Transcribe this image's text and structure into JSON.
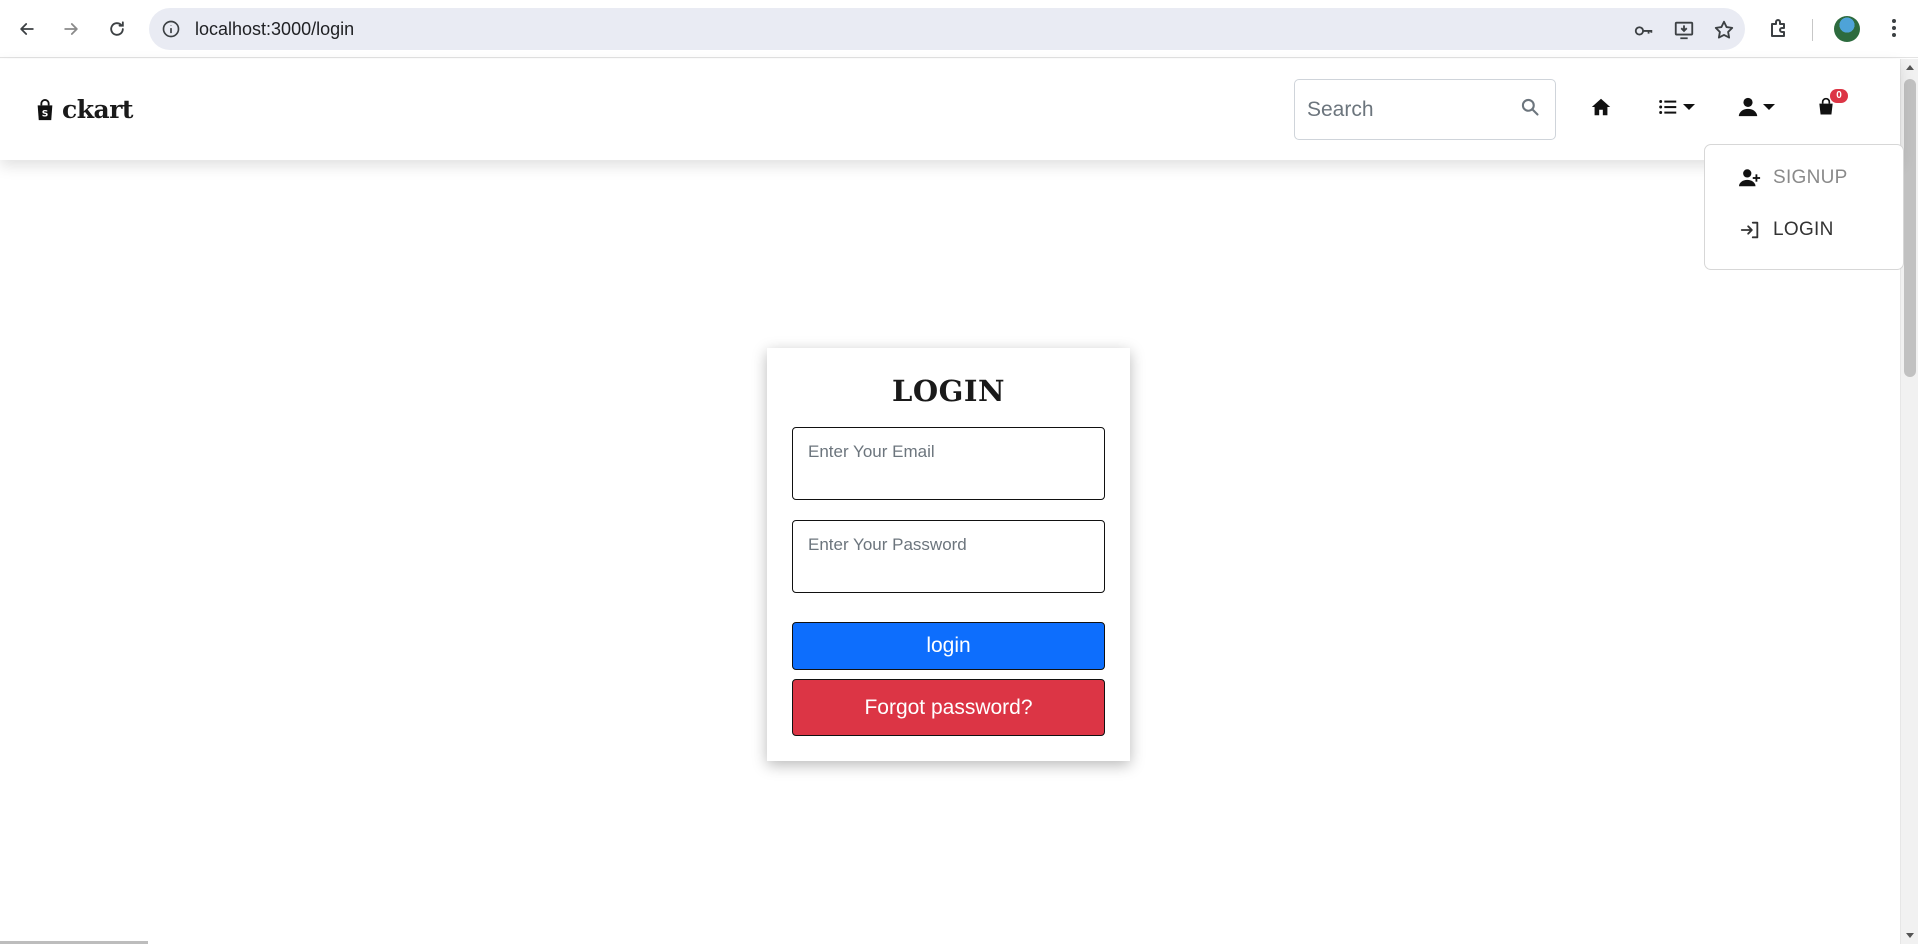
{
  "browser": {
    "url": "localhost:3000/login"
  },
  "header": {
    "brand": "ckart",
    "search_placeholder": "Search",
    "cart_count": "0"
  },
  "dropdown": {
    "items": [
      {
        "label": "SIGNUP"
      },
      {
        "label": "LOGIN"
      }
    ]
  },
  "login": {
    "title": "LOGIN",
    "email_placeholder": "Enter Your Email",
    "password_placeholder": "Enter Your Password",
    "login_label": "login",
    "forgot_label": "Forgot password?"
  },
  "colors": {
    "primary": "#0d6efd",
    "danger": "#dc3545",
    "badge": "#dc3545"
  },
  "icons": [
    "back-icon",
    "forward-icon",
    "reload-icon",
    "site-info-icon",
    "password-key-icon",
    "install-app-icon",
    "bookmark-star-icon",
    "extensions-icon",
    "menu-dots-icon",
    "shopping-bag-icon",
    "search-icon",
    "home-icon",
    "list-icon",
    "user-icon",
    "cart-icon",
    "user-plus-icon",
    "sign-in-icon"
  ]
}
